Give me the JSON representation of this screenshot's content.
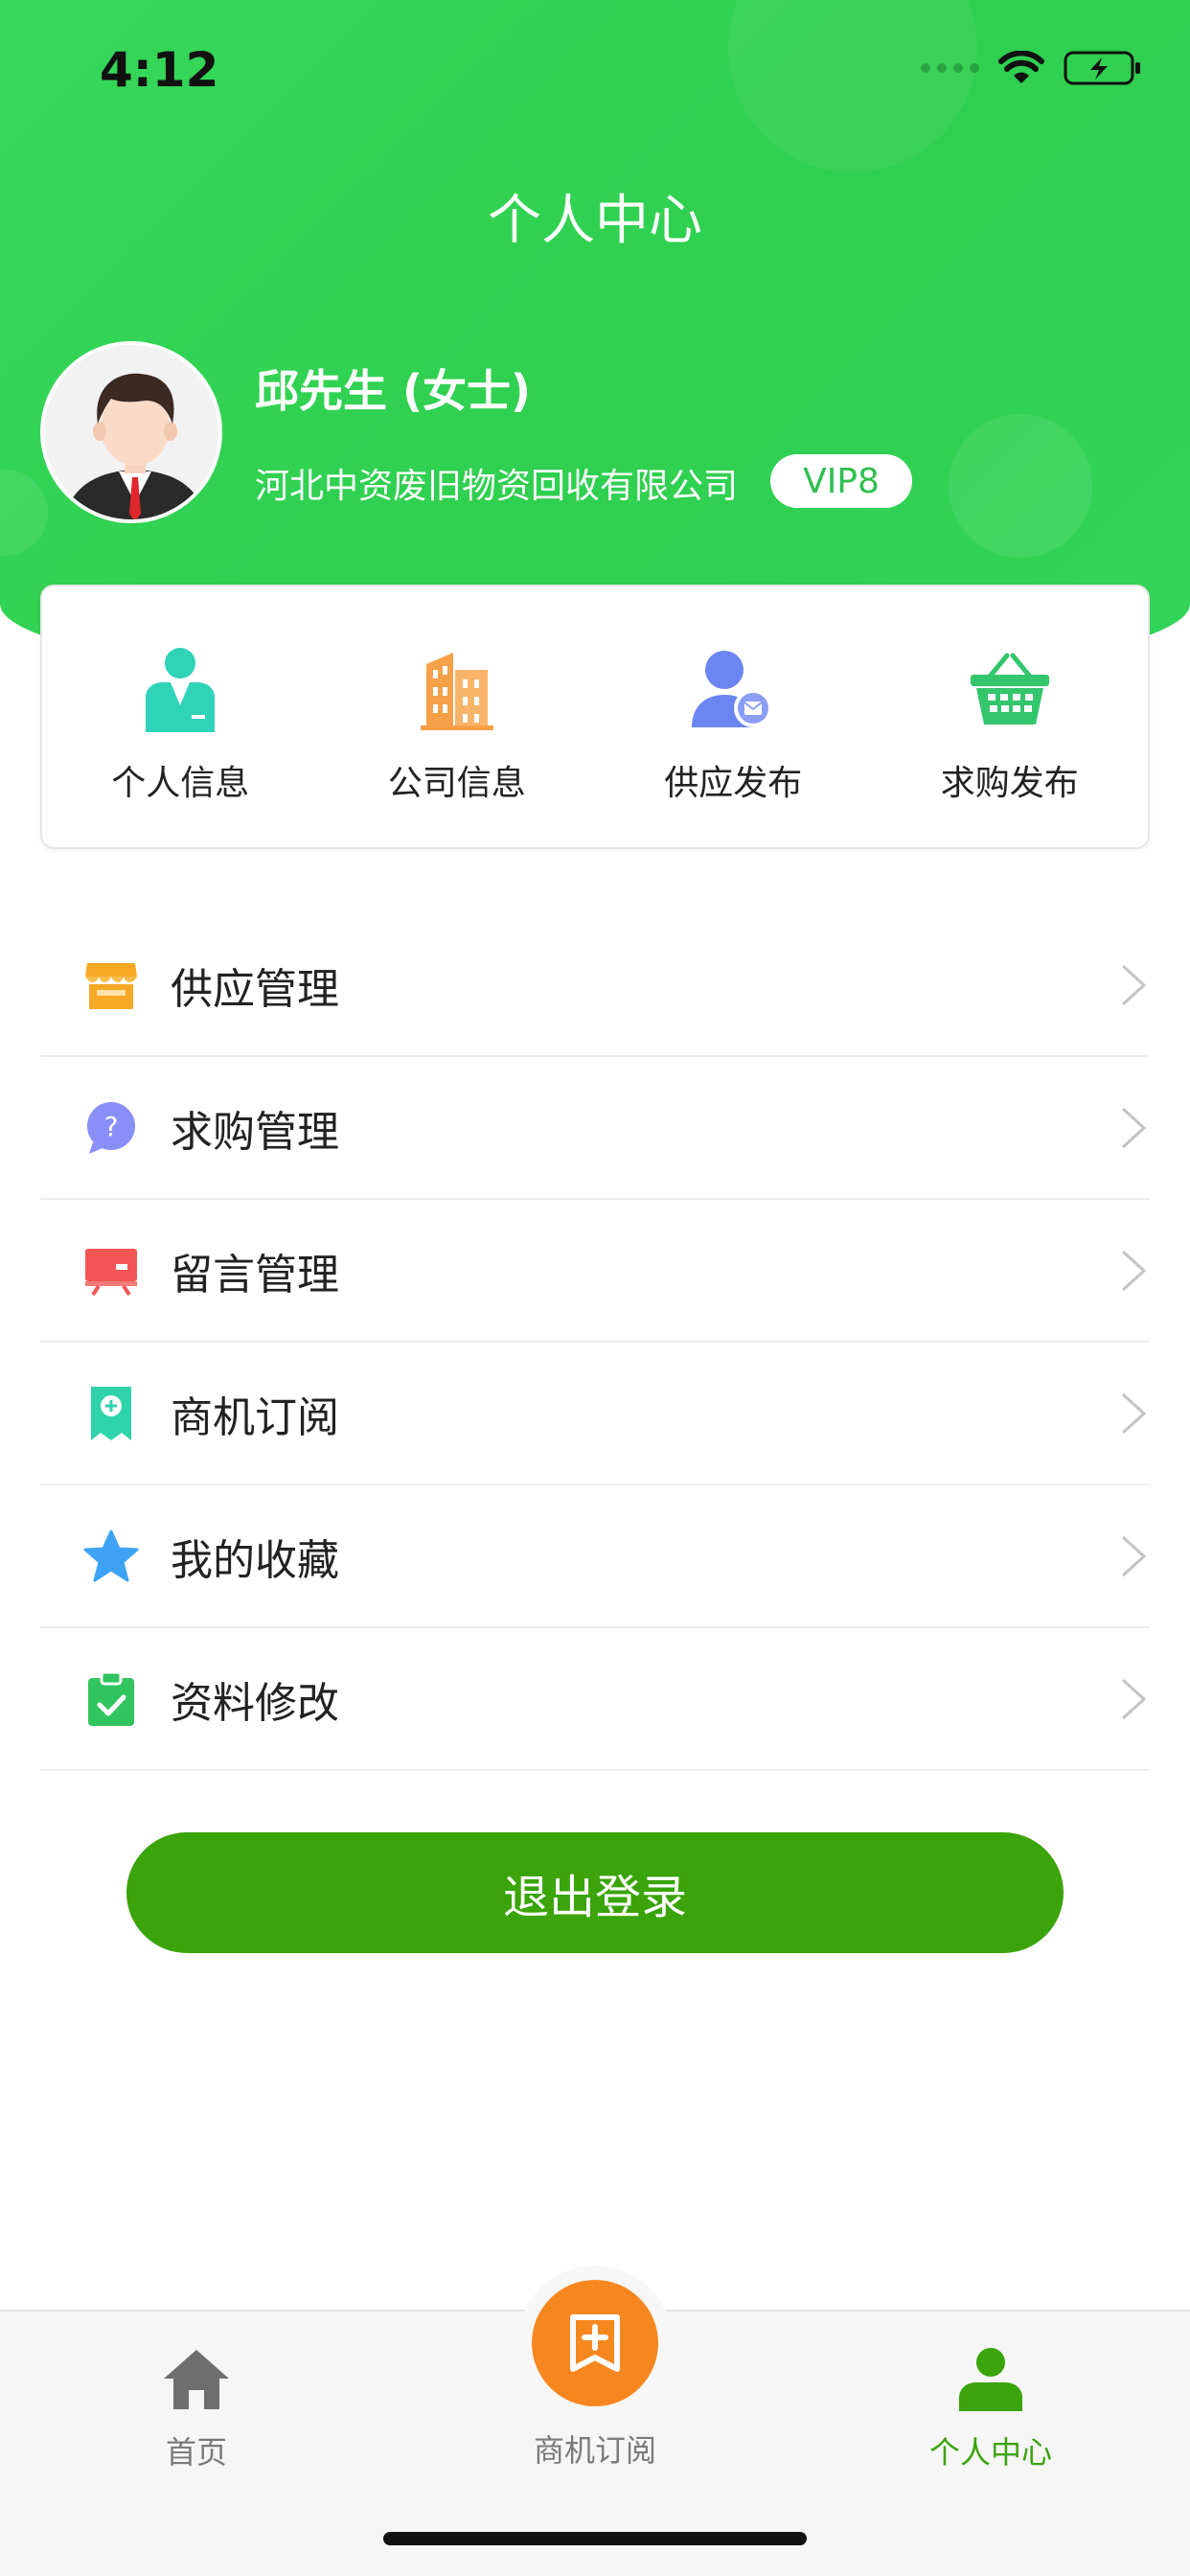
{
  "status_bar": {
    "time": "4:12"
  },
  "header": {
    "title": "个人中心"
  },
  "profile": {
    "name": "邱先生 (女士)",
    "company": "河北中资废旧物资回收有限公司",
    "vip": "VIP8"
  },
  "quick_actions": [
    {
      "label": "个人信息",
      "icon": "person-suit-icon",
      "color": "#2ed3b8"
    },
    {
      "label": "公司信息",
      "icon": "building-icon",
      "color": "#f6a14a"
    },
    {
      "label": "供应发布",
      "icon": "user-message-icon",
      "color": "#6b85f2"
    },
    {
      "label": "求购发布",
      "icon": "basket-icon",
      "color": "#33c66d"
    }
  ],
  "menu": [
    {
      "label": "供应管理",
      "icon": "store-icon",
      "color": "#f7a825"
    },
    {
      "label": "求购管理",
      "icon": "question-bubble-icon",
      "color": "#7d82f5"
    },
    {
      "label": "留言管理",
      "icon": "message-board-icon",
      "color": "#f25555"
    },
    {
      "label": "商机订阅",
      "icon": "subscription-ticket-icon",
      "color": "#2fd3a9"
    },
    {
      "label": "我的收藏",
      "icon": "star-icon",
      "color": "#3fa3f5"
    },
    {
      "label": "资料修改",
      "icon": "clipboard-check-icon",
      "color": "#32c45e"
    }
  ],
  "logout_label": "退出登录",
  "tabbar": {
    "home": "首页",
    "subscribe": "商机订阅",
    "me": "个人中心"
  },
  "colors": {
    "brand_green": "#36d85a",
    "button_green": "#3aa40a",
    "center_orange": "#f6871f"
  }
}
